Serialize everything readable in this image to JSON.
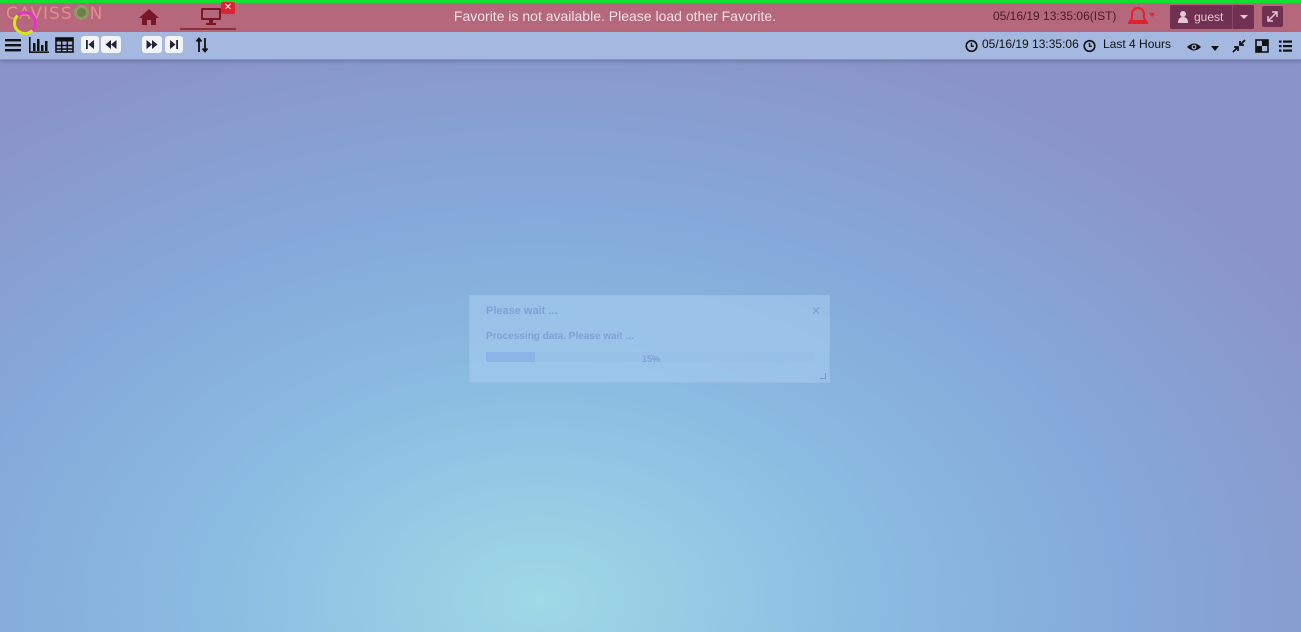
{
  "header": {
    "logo_text": "CAVISS",
    "logo_text_end": "N",
    "banner": "Favorite is not available. Please load other Favorite.",
    "datetime": "05/16/19 13:35:06(IST)",
    "user_label": "guest",
    "close_tab_glyph": "✕"
  },
  "toolbar": {
    "datetime": "05/16/19 13:35:06",
    "time_range": "Last 4 Hours"
  },
  "dialog": {
    "title": "Please wait ...",
    "message": "Processing data. Please wait ...",
    "progress_label": "15%",
    "progress": 0.15,
    "close_glyph": "✕"
  },
  "colors": {
    "header_bg": "#b5687b",
    "header_top_border": "#10e030",
    "toolbar_bg": "#a5b9e0",
    "user_button_bg": "#6f3051"
  }
}
